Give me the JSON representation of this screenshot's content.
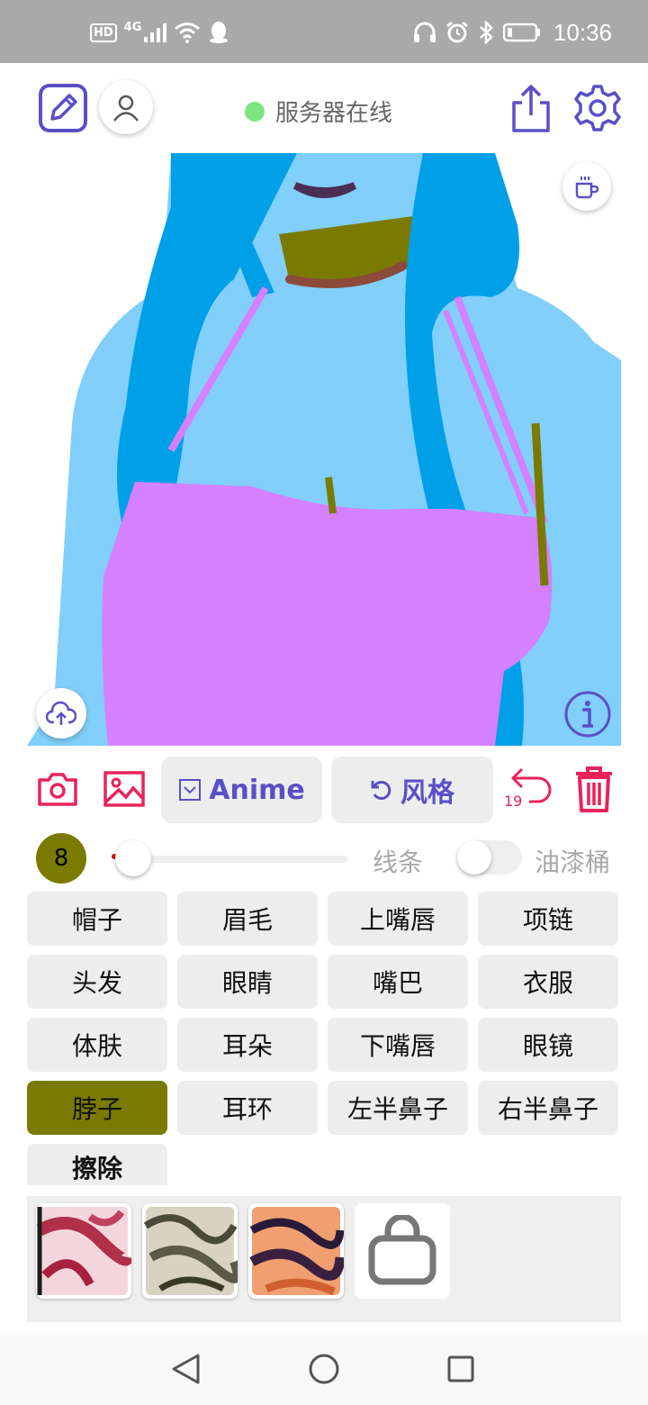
{
  "status_bar": {
    "network_badges": [
      "HD",
      "4G"
    ],
    "time": "10:36"
  },
  "header": {
    "server_status": "服务器在线",
    "server_status_color": "#7fe57f",
    "icons": [
      "edit-icon",
      "user-icon",
      "share-icon",
      "settings-icon"
    ]
  },
  "actions": {
    "anime_label": "Anime",
    "style_label": "风格",
    "undo_count": "19",
    "accent_color": "#5b4fc7",
    "danger_color": "#e8235a"
  },
  "brush": {
    "size": "8",
    "size_color": "#7a7a00",
    "slider_fraction": 0.0,
    "line_label": "线条",
    "bucket_label": "油漆桶",
    "bucket_on": false
  },
  "labels": [
    [
      "帽子",
      "眉毛",
      "上嘴唇",
      "项链"
    ],
    [
      "头发",
      "眼睛",
      "嘴巴",
      "衣服"
    ],
    [
      "体肤",
      "耳朵",
      "下嘴唇",
      "眼镜"
    ],
    [
      "脖子",
      "耳环",
      "左半鼻子",
      "右半鼻子"
    ],
    [
      "擦除"
    ]
  ],
  "active_label": "脖子",
  "textures": [
    "texture-red",
    "texture-grey",
    "texture-orange",
    "shop-bag-icon"
  ]
}
